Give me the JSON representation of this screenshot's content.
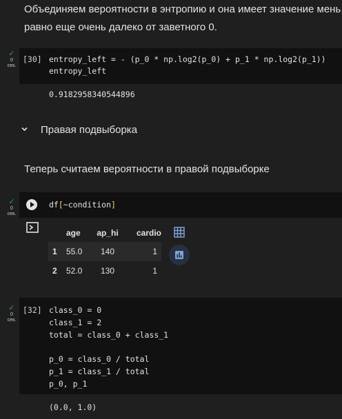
{
  "markdown_top": {
    "line1": "Объединяем вероятности в энтропию и она имеет значение мень",
    "line2": "равно еще очень далеко от заветного 0."
  },
  "cell30": {
    "status_time": "0",
    "status_unit": "сек.",
    "prompt": "[30]",
    "code": [
      "entropy_left = - (p_0 * np.log2(p_0) + p_1 * np.log2(p_1))",
      "entropy_left"
    ],
    "output": "0.9182958340544896"
  },
  "section": {
    "title": "Правая подвыборка"
  },
  "markdown_right": {
    "text": "Теперь считаем вероятности в правой подвыборке"
  },
  "cell31": {
    "status_time": "0",
    "status_unit": "сек.",
    "code_main": "df",
    "code_bracket_open": "[",
    "code_inner": "~condition",
    "code_bracket_close": "]",
    "table": {
      "columns": [
        "age",
        "ap_hi",
        "cardio"
      ],
      "rows": [
        {
          "index": "1",
          "values": [
            "55.0",
            "140",
            "1"
          ]
        },
        {
          "index": "2",
          "values": [
            "52.0",
            "130",
            "1"
          ]
        }
      ]
    },
    "icons": [
      "table-view-icon",
      "suggest-chart-icon",
      "output-icon"
    ]
  },
  "cell32": {
    "status_time": "0",
    "status_unit": "сек.",
    "prompt": "[32]",
    "code": [
      "class_0 = 0",
      "class_1 = 2",
      "total = class_0 + class_1",
      "",
      "p_0 = class_0 / total",
      "p_1 = class_1 / total",
      "p_0, p_1"
    ],
    "output": "(0.0, 1.0)"
  },
  "colors": {
    "check": "#2ea043",
    "code_bg": "#111111",
    "page_bg": "#1f1f1f",
    "bracket": "#f9d849"
  }
}
